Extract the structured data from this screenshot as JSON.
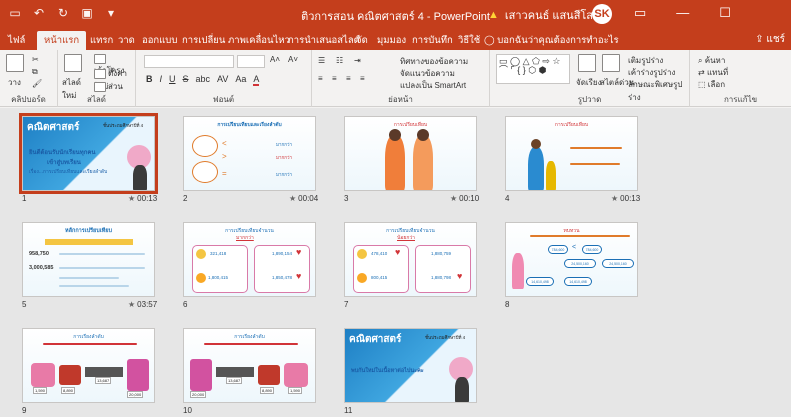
{
  "titlebar": {
    "title": "ติวการสอน คณิตศาสตร์ 4 - PowerPoint",
    "warning": "เสาวคนธ์ แสนสีโส",
    "avatar_initials": "SK",
    "qat_icons": [
      "save-icon",
      "undo-icon",
      "redo-icon",
      "start-from-beginning-icon",
      "customize-qat-icon"
    ],
    "window_buttons": [
      "ribbon-display-icon",
      "minimize-icon",
      "maximize-icon"
    ]
  },
  "tabs": [
    "ไฟล์",
    "หน้าแรก",
    "แทรก",
    "วาด",
    "ออกแบบ",
    "การเปลี่ยน",
    "ภาพเคลื่อนไหว",
    "การนำเสนอสไลด์",
    "จัด",
    "มุมมอง",
    "การบันทึก",
    "วิธีใช้",
    "บอกฉันว่าคุณต้องการทำอะไร"
  ],
  "active_tab_index": 1,
  "share_label": "แชร์",
  "ribbon": {
    "groups": [
      "คลิปบอร์ด",
      "สไลด์",
      "ฟอนต์",
      "ย่อหน้า",
      "รูปวาด",
      "การแก้ไข"
    ],
    "clipboard": {
      "paste": "วาง"
    },
    "slides": {
      "new_slide": "สไลด์ ใหม่",
      "layout": "เค้าโครง",
      "reset": "ตั้งค่าใหม่",
      "section": "ส่วน"
    },
    "font": {
      "format_buttons": [
        "B",
        "I",
        "U",
        "S",
        "abc",
        "AV",
        "Aa"
      ]
    },
    "paragraph": {
      "direction": "ทิศทางของข้อความ",
      "align": "จัดแนวข้อความ",
      "smartart": "แปลงเป็น SmartArt"
    },
    "drawing": {
      "arrange": "จัดเรียง",
      "quick_styles": "สไตล์ด่วน",
      "fill": "เติมรูปร่าง",
      "outline": "เค้าร่างรูปร่าง",
      "effects": "ลักษณะพิเศษรูปร่าง"
    },
    "editing": {
      "find": "ค้นหา",
      "replace": "แทนที่",
      "select": "เลือก"
    }
  },
  "slides": [
    {
      "num": "1",
      "time": "00:13",
      "title": "คณิตศาสตร์",
      "subtitle": "ชั้นประถมศึกษาปีที่ 4",
      "text1": "ยินดีต้อนรับนักเรียนทุกคน",
      "text2": "เข้าสู่บทเรียน",
      "text3": "เรื่อง...การเปรียบเทียบและเรียงลำดับ"
    },
    {
      "num": "2",
      "time": "00:04",
      "title": "การเปรียบเทียบและเรียงลำดับ",
      "rows": [
        "มากกว่า",
        "มากกว่า",
        "มากกว่า"
      ]
    },
    {
      "num": "3",
      "time": "00:10",
      "title": "การเปรียบเทียบ"
    },
    {
      "num": "4",
      "time": "00:13",
      "title": "การเปรียบเทียบ"
    },
    {
      "num": "5",
      "time": "03:57",
      "title": "หลักการเปรียบเทียบ",
      "n1": "958,750",
      "n2": "3,000,585"
    },
    {
      "num": "6",
      "time": "",
      "title": "การเปรียบเทียบจำนวน",
      "label": "มากกว่า",
      "v1": "321,418",
      "v2": "1,800,415",
      "v3": "1,890,154",
      "v4": "1,850,478"
    },
    {
      "num": "7",
      "time": "",
      "title": "การเปรียบเทียบจำนวน",
      "label": "น้อยกว่า",
      "v1": "478,410",
      "v2": "1,880,759",
      "v3": "800,415",
      "v4": "1,880,798"
    },
    {
      "num": "8",
      "time": "",
      "title": "ทบทวน",
      "v1": "784,600",
      "v2": "784,600",
      "v3": "24,500,160",
      "v4": "24,500,160",
      "v5": "14,610,498",
      "v6": "14,610,498"
    },
    {
      "num": "9",
      "time": "",
      "title": "การเรียงลำดับ",
      "prices": [
        "1,590",
        "8,890",
        "13,687",
        "20,000"
      ]
    },
    {
      "num": "10",
      "time": "",
      "title": "การเรียงลำดับ",
      "prices": [
        "20,000",
        "13,687",
        "8,890",
        "1,590"
      ]
    },
    {
      "num": "11",
      "time": "",
      "title": "คณิตศาสตร์",
      "subtitle": "ชั้นประถมศึกษาปีที่ 4",
      "text1": "พบกันใหม่ในเนื้อหาต่อไปนะคะ"
    }
  ]
}
